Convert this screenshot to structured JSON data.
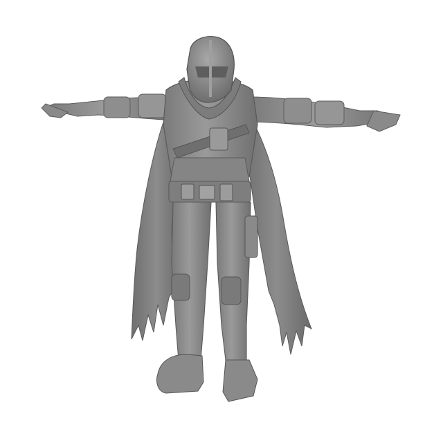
{
  "scene": {
    "subject_icon": "armored-cloaked-figure-icon",
    "background_color": "#ffffff",
    "model_color": "#8a8a8a",
    "model_shadow": "#5e5e5e",
    "model_highlight": "#b5b5b5"
  }
}
